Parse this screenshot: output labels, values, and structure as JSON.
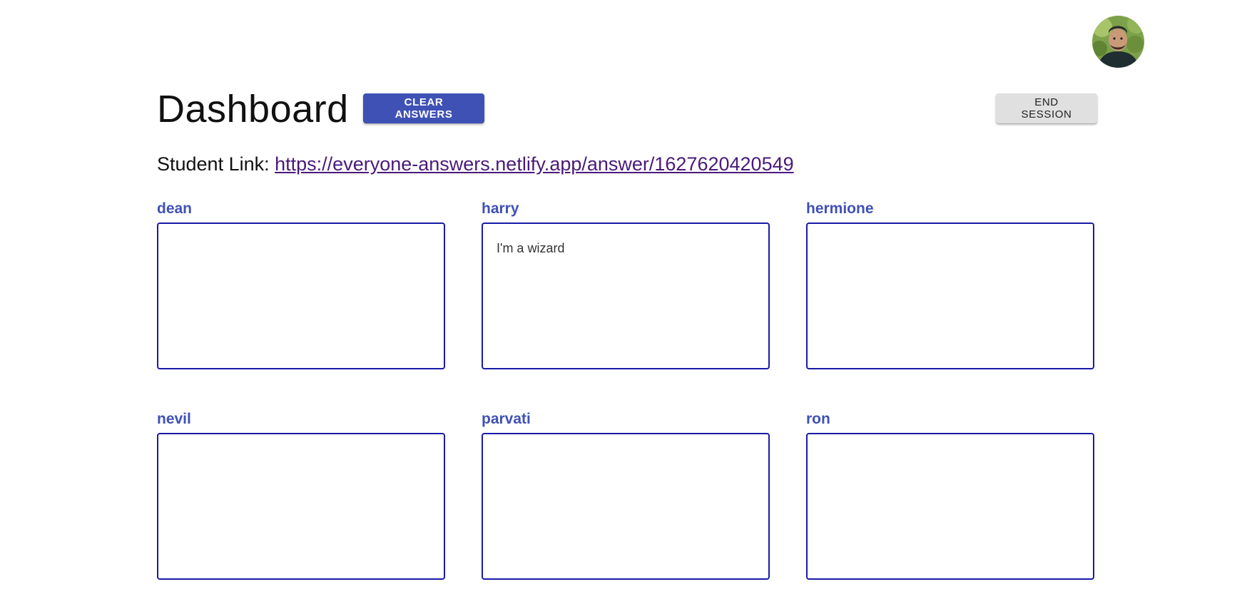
{
  "header": {
    "title": "Dashboard",
    "clear_answers_label": "CLEAR ANSWERS",
    "end_session_label": "END SESSION"
  },
  "student_link": {
    "label": "Student Link:",
    "url": "https://everyone-answers.netlify.app/answer/1627620420549"
  },
  "colors": {
    "primary": "#3f51b5",
    "box_border": "#1a1aa6",
    "link": "#4a1a7a",
    "button_default": "#e0e0e0"
  },
  "students": [
    {
      "name": "dean",
      "answer": ""
    },
    {
      "name": "harry",
      "answer": "I'm a wizard"
    },
    {
      "name": "hermione",
      "answer": ""
    },
    {
      "name": "nevil",
      "answer": ""
    },
    {
      "name": "parvati",
      "answer": ""
    },
    {
      "name": "ron",
      "answer": ""
    }
  ]
}
